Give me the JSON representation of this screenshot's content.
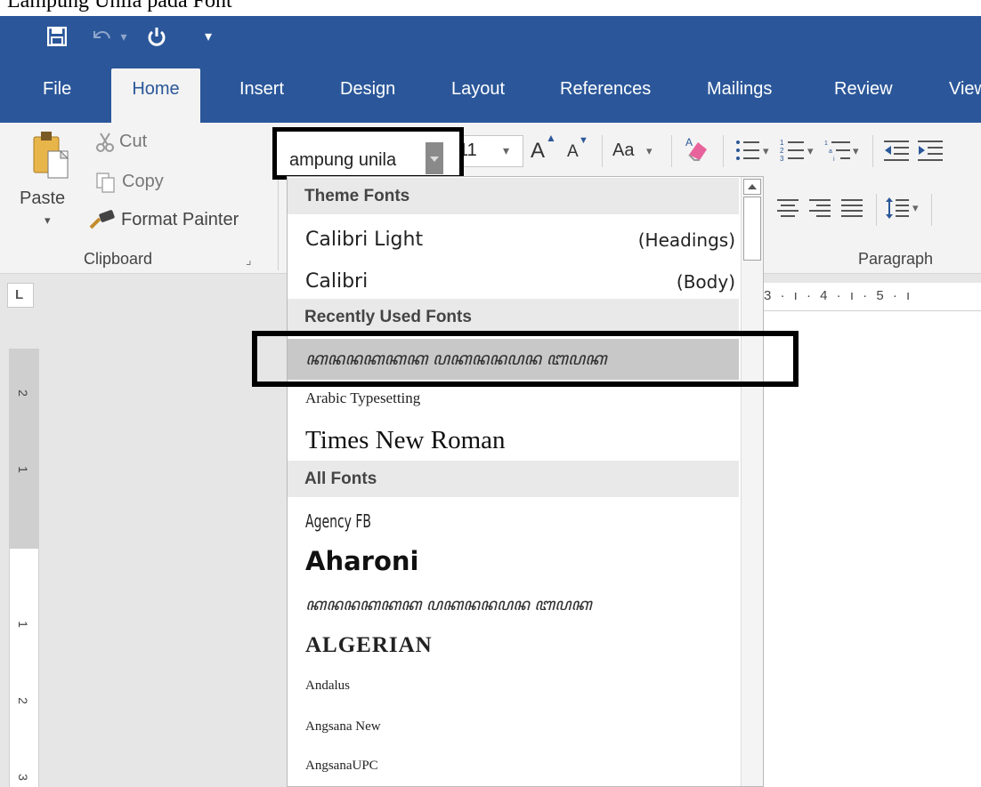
{
  "page": {
    "caption": "Lampung Unila pada Font"
  },
  "qat": {
    "more_glyph": "▾"
  },
  "tabs": [
    "File",
    "Home",
    "Insert",
    "Design",
    "Layout",
    "References",
    "Mailings",
    "Review",
    "View"
  ],
  "clipboard": {
    "paste_label": "Paste",
    "paste_arrow": "▾",
    "cut_label": "Cut",
    "copy_label": "Copy",
    "format_painter_label": "Format Painter",
    "group_label": "Clipboard",
    "launcher_glyph": "⌟"
  },
  "font": {
    "name_value": "ampung unila",
    "size_value": "11",
    "grow_label": "A",
    "shrink_label": "A",
    "case_label": "Aa",
    "dropdown_glyph": "▾"
  },
  "paragraph": {
    "group_label": "Paragraph"
  },
  "ruler": {
    "corner": "L",
    "h_marks": "3 · ı · 4 · ı · 5 · ı",
    "v_marks": [
      "2",
      "1",
      "1",
      "2",
      "3"
    ]
  },
  "font_list": {
    "headers": {
      "theme": "Theme Fonts",
      "recent": "Recently Used Fonts",
      "all": "All Fonts"
    },
    "theme_fonts": [
      {
        "name": "Calibri Light",
        "tag": "(Headings)"
      },
      {
        "name": "Calibri",
        "tag": "(Body)"
      }
    ],
    "recent_fonts": [
      {
        "name": "𐀀 Lampung Unila",
        "display": "ꦏꦤꦤꦏꦏꦏ ꦥꦏꦤꦤꦥꦤ ꦧꦥꦏ",
        "selected": true
      },
      {
        "name": "Arabic Typesetting"
      },
      {
        "name": "Times New Roman"
      }
    ],
    "all_fonts": [
      "Agency FB",
      "Aharoni",
      "ꦏꦤꦤꦏꦏꦏ ꦥꦏꦤꦤꦥꦤ ꦧꦥꦏ",
      "ALGERIAN",
      "Andalus",
      "Angsana New",
      "AngsanaUPC"
    ]
  },
  "colors": {
    "ribbon_blue": "#2b579a",
    "ribbon_bg": "#f3f3f3",
    "selected_row": "#c8c8c8",
    "highlight_border": "#000000"
  }
}
